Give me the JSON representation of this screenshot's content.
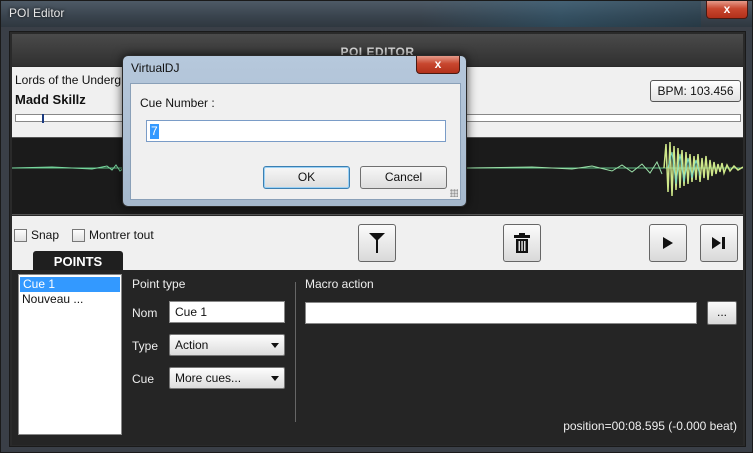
{
  "window": {
    "title": "POI Editor",
    "close_glyph": "x"
  },
  "header": {
    "title": "POI EDITOR"
  },
  "track": {
    "title": "Lords of the Underg",
    "artist": "Madd Skillz",
    "bpm": "BPM: 103.456"
  },
  "controls": {
    "snap_label": "Snap",
    "show_all_label": "Montrer tout"
  },
  "points_tab": {
    "label": "POINTS"
  },
  "poi_list": {
    "items": [
      "Cue 1",
      "Nouveau ..."
    ]
  },
  "point_type": {
    "heading": "Point type",
    "name_label": "Nom",
    "name_value": "Cue 1",
    "type_label": "Type",
    "type_value": "Action",
    "cue_label": "Cue",
    "cue_value": "More cues..."
  },
  "macro": {
    "heading": "Macro action",
    "value": "",
    "browse_label": "..."
  },
  "status": {
    "position": "position=00:08.595 (-0.000 beat)"
  },
  "dialog": {
    "title": "VirtualDJ",
    "close_glyph": "x",
    "prompt": "Cue Number :",
    "value": "7",
    "ok_label": "OK",
    "cancel_label": "Cancel"
  },
  "icons": {
    "marker": "marker-icon",
    "delete": "trash-icon",
    "play": "play-icon",
    "next": "skip-next-icon"
  },
  "colors": {
    "accent": "#3399ff",
    "waveform": "#7ad9a0",
    "waveform_peak": "#e6f07a"
  }
}
